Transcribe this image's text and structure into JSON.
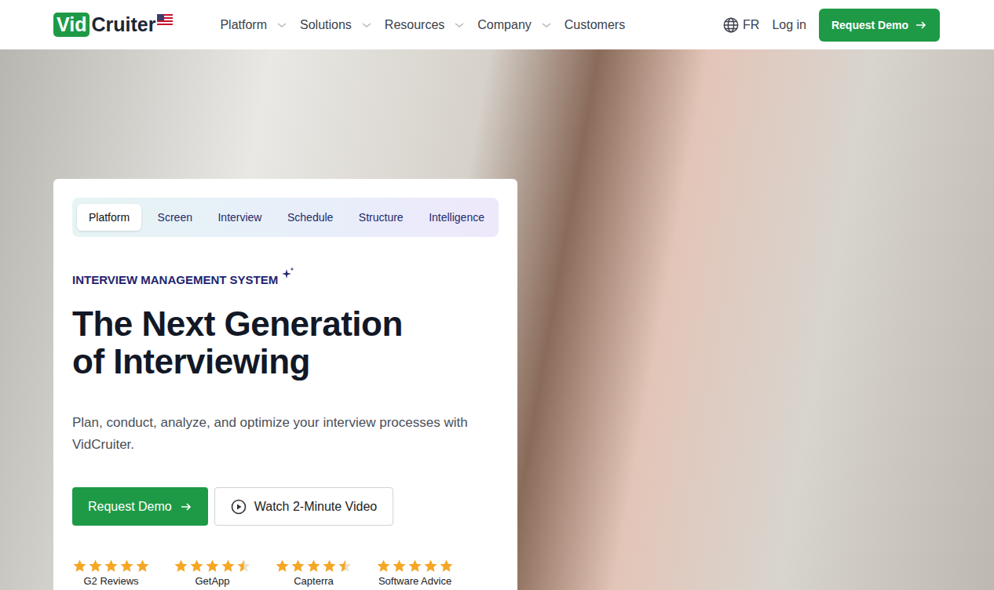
{
  "header": {
    "logo": {
      "highlight": "Vid",
      "rest": "Cruiter"
    },
    "nav": [
      {
        "label": "Platform",
        "has_menu": true
      },
      {
        "label": "Solutions",
        "has_menu": true
      },
      {
        "label": "Resources",
        "has_menu": true
      },
      {
        "label": "Company",
        "has_menu": true
      },
      {
        "label": "Customers",
        "has_menu": false
      }
    ],
    "language": "FR",
    "login": "Log in",
    "cta": "Request Demo"
  },
  "hero": {
    "tabs": [
      {
        "label": "Platform",
        "selected": true
      },
      {
        "label": "Screen",
        "selected": false
      },
      {
        "label": "Interview",
        "selected": false
      },
      {
        "label": "Schedule",
        "selected": false
      },
      {
        "label": "Structure",
        "selected": false
      },
      {
        "label": "Intelligence",
        "selected": false
      }
    ],
    "eyebrow": "INTERVIEW MANAGEMENT SYSTEM",
    "title": "The Next Generation of Interviewing",
    "subtitle": "Plan, conduct, analyze, and optimize your interview processes with VidCruiter.",
    "buttons": [
      {
        "label": "Request Demo",
        "kind": "primary"
      },
      {
        "label": "Watch 2-Minute Video",
        "kind": "video"
      }
    ],
    "ratings": [
      {
        "source": "G2 Reviews",
        "stars": 5
      },
      {
        "source": "GetApp",
        "stars": 4.5
      },
      {
        "source": "Capterra",
        "stars": 4.5
      },
      {
        "source": "Software Advice",
        "stars": 5
      }
    ]
  }
}
